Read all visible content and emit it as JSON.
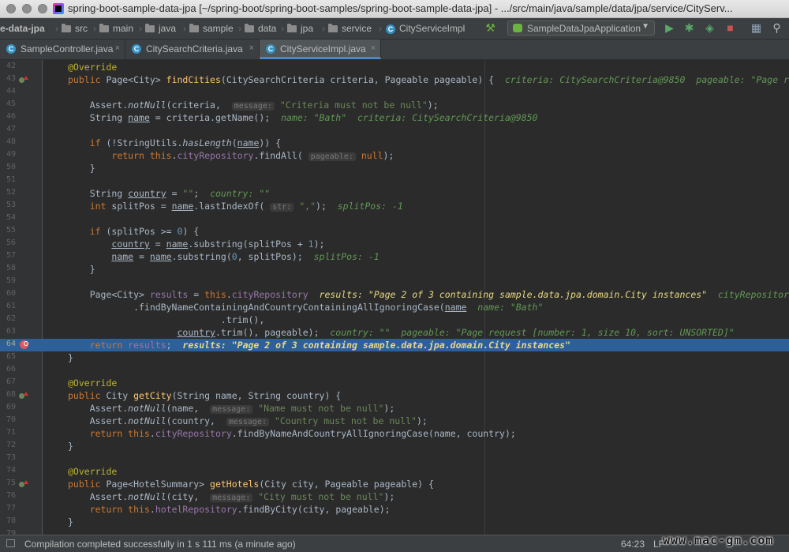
{
  "window": {
    "title": "spring-boot-sample-data-jpa [~/spring-boot/spring-boot-samples/spring-boot-sample-data-jpa] - .../src/main/java/sample/data/jpa/service/CityServ..."
  },
  "breadcrumbs": [
    "e-data-jpa",
    "src",
    "main",
    "java",
    "sample",
    "data",
    "jpa",
    "service",
    "CityServiceImpl"
  ],
  "run_config": {
    "label": "SampleDataJpaApplication"
  },
  "toolbar_icons": [
    "hammer-icon",
    "run-icon",
    "debug-icon",
    "coverage-icon",
    "stop-icon",
    "project-structure-icon",
    "search-icon"
  ],
  "tabs": [
    {
      "label": "SampleController.java",
      "active": false
    },
    {
      "label": "CitySearchCriteria.java",
      "active": false
    },
    {
      "label": "CityServiceImpl.java",
      "active": true
    }
  ],
  "editor": {
    "lines": [
      {
        "n": "42",
        "text": "@Override"
      },
      {
        "n": "43",
        "text": "public Page<City> findCities(CitySearchCriteria criteria, Pageable pageable) {  criteria: CitySearchCriteria@9850  pageable: \"Page r"
      },
      {
        "n": "44",
        "text": ""
      },
      {
        "n": "45",
        "text": "Assert.notNull(criteria, message: \"Criteria must not be null\");"
      },
      {
        "n": "46",
        "text": "String name = criteria.getName();  name: \"Bath\"  criteria: CitySearchCriteria@9850"
      },
      {
        "n": "47",
        "text": ""
      },
      {
        "n": "48",
        "text": "if (!StringUtils.hasLength(name)) {"
      },
      {
        "n": "49",
        "text": "return this.cityRepository.findAll( pageable: null);"
      },
      {
        "n": "50",
        "text": "}"
      },
      {
        "n": "51",
        "text": ""
      },
      {
        "n": "52",
        "text": "String country = \"\";  country: \"\""
      },
      {
        "n": "53",
        "text": "int splitPos = name.lastIndexOf( str: \",\");  splitPos: -1"
      },
      {
        "n": "54",
        "text": ""
      },
      {
        "n": "55",
        "text": "if (splitPos >= 0) {"
      },
      {
        "n": "56",
        "text": "country = name.substring(splitPos + 1);"
      },
      {
        "n": "57",
        "text": "name = name.substring(0, splitPos);  splitPos: -1"
      },
      {
        "n": "58",
        "text": "}"
      },
      {
        "n": "59",
        "text": ""
      },
      {
        "n": "60",
        "text": "Page<City> results = this.cityRepository  results: \"Page 2 of 3 containing sample.data.jpa.domain.City instances\"  cityRepositor"
      },
      {
        "n": "61",
        "text": ".findByNameContainingAndCountryContainingAllIgnoringCase(name  name: \"Bath\""
      },
      {
        "n": "62",
        "text": ".trim(),"
      },
      {
        "n": "63",
        "text": "country.trim(), pageable);  country: \"\"  pageable: \"Page request [number: 1, size 10, sort: UNSORTED]\""
      },
      {
        "n": "64",
        "text": "return results;  results: \"Page 2 of 3 containing sample.data.jpa.domain.City instances\""
      },
      {
        "n": "65",
        "text": "}"
      },
      {
        "n": "66",
        "text": ""
      },
      {
        "n": "67",
        "text": "@Override"
      },
      {
        "n": "68",
        "text": "public City getCity(String name, String country) {"
      },
      {
        "n": "69",
        "text": "Assert.notNull(name, message: \"Name must not be null\");"
      },
      {
        "n": "70",
        "text": "Assert.notNull(country, message: \"Country must not be null\");"
      },
      {
        "n": "71",
        "text": "return this.cityRepository.findByNameAndCountryAllIgnoringCase(name, country);"
      },
      {
        "n": "72",
        "text": "}"
      },
      {
        "n": "73",
        "text": ""
      },
      {
        "n": "74",
        "text": "@Override"
      },
      {
        "n": "75",
        "text": "public Page<HotelSummary> getHotels(City city, Pageable pageable) {"
      },
      {
        "n": "76",
        "text": "Assert.notNull(city, message: \"City must not be null\");"
      },
      {
        "n": "77",
        "text": "return this.hotelRepository.findByCity(city, pageable);"
      },
      {
        "n": "78",
        "text": "}"
      },
      {
        "n": "79",
        "text": ""
      }
    ],
    "current_line": "64"
  },
  "status": {
    "message": "Compilation completed successfully in 1 s 111 ms (a minute ago)",
    "position": "64:23",
    "line_separator": "LF"
  },
  "watermark": "www.mac-gm.com",
  "colors": {
    "editor_bg": "#2b2b2b",
    "keyword": "#cc7832",
    "string": "#6a8759",
    "debug_value": "#629755",
    "execution_line": "#2d6099"
  }
}
